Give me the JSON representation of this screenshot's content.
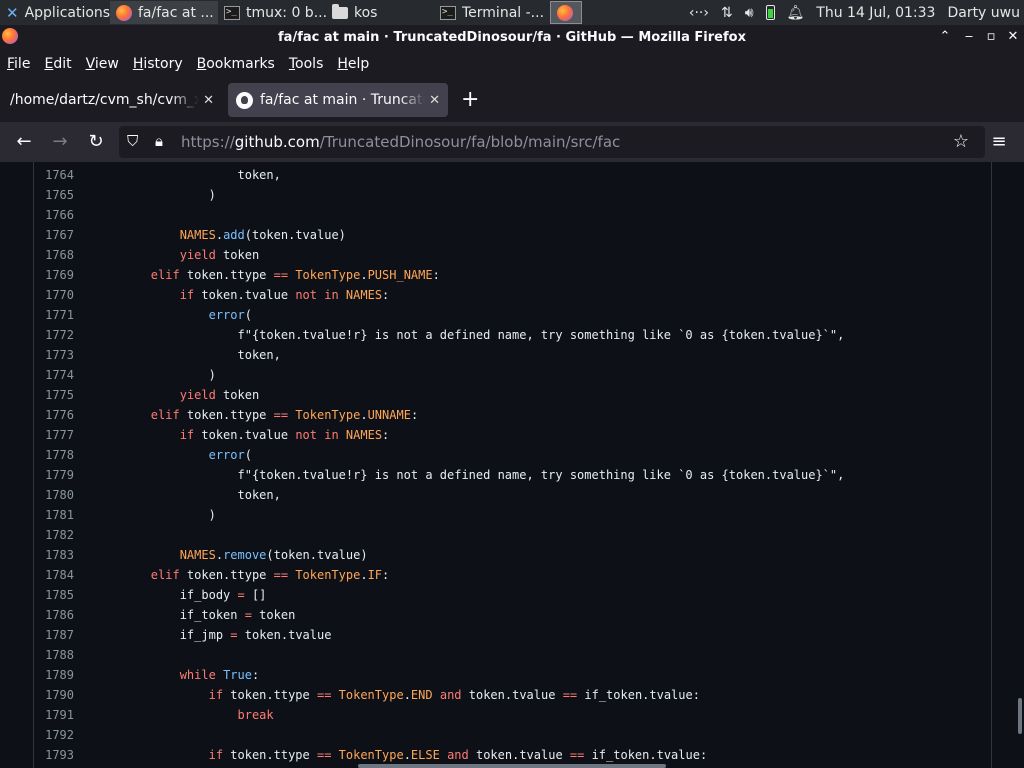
{
  "panel": {
    "apps_label": "Applications",
    "tasks": [
      {
        "label": "fa/fac at ..."
      },
      {
        "label": "tmux: 0 b..."
      },
      {
        "label": "kos"
      },
      {
        "label": "Terminal -..."
      }
    ],
    "network_label": "‹··›",
    "datetime": "Thu 14 Jul, 01:33",
    "user": "Darty uwu"
  },
  "window": {
    "title": "fa/fac at main · TruncatedDinosour/fa · GitHub — Mozilla Firefox"
  },
  "menu": [
    "File",
    "Edit",
    "View",
    "History",
    "Bookmarks",
    "Tools",
    "Help"
  ],
  "tabs": [
    {
      "label": "/home/dartz/cvm_sh/cvm_xf"
    },
    {
      "label": "fa/fac at main · Truncated"
    }
  ],
  "url": {
    "prefix": "https://",
    "host": "github.com",
    "path": "/TruncatedDinosour/fa/blob/main/src/fac"
  },
  "code": {
    "lines": [
      {
        "n": "1764",
        "t": [
          [
            "",
            "                    token,"
          ]
        ]
      },
      {
        "n": "1765",
        "t": [
          [
            "",
            "                )"
          ]
        ]
      },
      {
        "n": "1766",
        "t": [
          [
            "",
            ""
          ]
        ]
      },
      {
        "n": "1767",
        "t": [
          [
            "",
            "            "
          ],
          [
            "c",
            "NAMES"
          ],
          [
            "",
            "."
          ],
          [
            "b",
            "add"
          ],
          [
            "",
            "(token.tvalue)"
          ]
        ]
      },
      {
        "n": "1768",
        "t": [
          [
            "",
            "            "
          ],
          [
            "k",
            "yield"
          ],
          [
            "",
            " token"
          ]
        ]
      },
      {
        "n": "1769",
        "t": [
          [
            "",
            "        "
          ],
          [
            "k",
            "elif"
          ],
          [
            "",
            " token.ttype "
          ],
          [
            "k",
            "=="
          ],
          [
            "",
            " "
          ],
          [
            "c",
            "TokenType"
          ],
          [
            "",
            "."
          ],
          [
            "c",
            "PUSH_NAME"
          ],
          [
            "",
            ":"
          ]
        ]
      },
      {
        "n": "1770",
        "t": [
          [
            "",
            "            "
          ],
          [
            "k",
            "if"
          ],
          [
            "",
            " token.tvalue "
          ],
          [
            "k",
            "not"
          ],
          [
            "",
            " "
          ],
          [
            "k",
            "in"
          ],
          [
            "",
            " "
          ],
          [
            "c",
            "NAMES"
          ],
          [
            "",
            ":"
          ]
        ]
      },
      {
        "n": "1771",
        "t": [
          [
            "",
            "                "
          ],
          [
            "b",
            "error"
          ],
          [
            "",
            "("
          ]
        ]
      },
      {
        "n": "1772",
        "t": [
          [
            "",
            "                    f\"{token.tvalue!r} is not a defined name, try something like `0 as {token.tvalue}`\","
          ]
        ]
      },
      {
        "n": "1773",
        "t": [
          [
            "",
            "                    token,"
          ]
        ]
      },
      {
        "n": "1774",
        "t": [
          [
            "",
            "                )"
          ]
        ]
      },
      {
        "n": "1775",
        "t": [
          [
            "",
            "            "
          ],
          [
            "k",
            "yield"
          ],
          [
            "",
            " token"
          ]
        ]
      },
      {
        "n": "1776",
        "t": [
          [
            "",
            "        "
          ],
          [
            "k",
            "elif"
          ],
          [
            "",
            " token.ttype "
          ],
          [
            "k",
            "=="
          ],
          [
            "",
            " "
          ],
          [
            "c",
            "TokenType"
          ],
          [
            "",
            "."
          ],
          [
            "c",
            "UNNAME"
          ],
          [
            "",
            ":"
          ]
        ]
      },
      {
        "n": "1777",
        "t": [
          [
            "",
            "            "
          ],
          [
            "k",
            "if"
          ],
          [
            "",
            " token.tvalue "
          ],
          [
            "k",
            "not"
          ],
          [
            "",
            " "
          ],
          [
            "k",
            "in"
          ],
          [
            "",
            " "
          ],
          [
            "c",
            "NAMES"
          ],
          [
            "",
            ":"
          ]
        ]
      },
      {
        "n": "1778",
        "t": [
          [
            "",
            "                "
          ],
          [
            "b",
            "error"
          ],
          [
            "",
            "("
          ]
        ]
      },
      {
        "n": "1779",
        "t": [
          [
            "",
            "                    f\"{token.tvalue!r} is not a defined name, try something like `0 as {token.tvalue}`\","
          ]
        ]
      },
      {
        "n": "1780",
        "t": [
          [
            "",
            "                    token,"
          ]
        ]
      },
      {
        "n": "1781",
        "t": [
          [
            "",
            "                )"
          ]
        ]
      },
      {
        "n": "1782",
        "t": [
          [
            "",
            ""
          ]
        ]
      },
      {
        "n": "1783",
        "t": [
          [
            "",
            "            "
          ],
          [
            "c",
            "NAMES"
          ],
          [
            "",
            "."
          ],
          [
            "b",
            "remove"
          ],
          [
            "",
            "(token.tvalue)"
          ]
        ]
      },
      {
        "n": "1784",
        "t": [
          [
            "",
            "        "
          ],
          [
            "k",
            "elif"
          ],
          [
            "",
            " token.ttype "
          ],
          [
            "k",
            "=="
          ],
          [
            "",
            " "
          ],
          [
            "c",
            "TokenType"
          ],
          [
            "",
            "."
          ],
          [
            "c",
            "IF"
          ],
          [
            "",
            ":"
          ]
        ]
      },
      {
        "n": "1785",
        "t": [
          [
            "",
            "            if_body "
          ],
          [
            "k",
            "="
          ],
          [
            "",
            " []"
          ]
        ]
      },
      {
        "n": "1786",
        "t": [
          [
            "",
            "            if_token "
          ],
          [
            "k",
            "="
          ],
          [
            "",
            " token"
          ]
        ]
      },
      {
        "n": "1787",
        "t": [
          [
            "",
            "            if_jmp "
          ],
          [
            "k",
            "="
          ],
          [
            "",
            " token.tvalue"
          ]
        ]
      },
      {
        "n": "1788",
        "t": [
          [
            "",
            ""
          ]
        ]
      },
      {
        "n": "1789",
        "t": [
          [
            "",
            "            "
          ],
          [
            "k",
            "while"
          ],
          [
            "",
            " "
          ],
          [
            "b",
            "True"
          ],
          [
            "",
            ":"
          ]
        ]
      },
      {
        "n": "1790",
        "t": [
          [
            "",
            "                "
          ],
          [
            "k",
            "if"
          ],
          [
            "",
            " token.ttype "
          ],
          [
            "k",
            "=="
          ],
          [
            "",
            " "
          ],
          [
            "c",
            "TokenType"
          ],
          [
            "",
            "."
          ],
          [
            "c",
            "END"
          ],
          [
            "",
            " "
          ],
          [
            "k",
            "and"
          ],
          [
            "",
            " token.tvalue "
          ],
          [
            "k",
            "=="
          ],
          [
            "",
            " if_token.tvalue:"
          ]
        ]
      },
      {
        "n": "1791",
        "t": [
          [
            "",
            "                    "
          ],
          [
            "k",
            "break"
          ]
        ]
      },
      {
        "n": "1792",
        "t": [
          [
            "",
            ""
          ]
        ]
      },
      {
        "n": "1793",
        "t": [
          [
            "",
            "                "
          ],
          [
            "k",
            "if"
          ],
          [
            "",
            " token.ttype "
          ],
          [
            "k",
            "=="
          ],
          [
            "",
            " "
          ],
          [
            "c",
            "TokenType"
          ],
          [
            "",
            "."
          ],
          [
            "c",
            "ELSE"
          ],
          [
            "",
            " "
          ],
          [
            "k",
            "and"
          ],
          [
            "",
            " token.tvalue "
          ],
          [
            "k",
            "=="
          ],
          [
            "",
            " if_token.tvalue:"
          ]
        ]
      }
    ]
  }
}
